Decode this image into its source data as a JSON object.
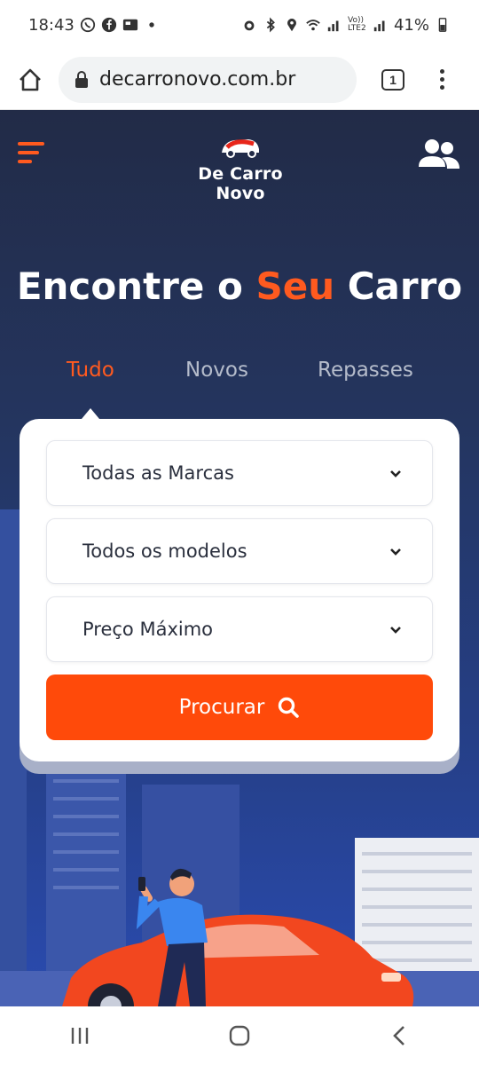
{
  "status_bar": {
    "time": "18:43",
    "battery": "41%",
    "network": "Vo)) LTE2"
  },
  "browser": {
    "url": "decarronovo.com.br",
    "tab_count": "1"
  },
  "site": {
    "logo_text": "De Carro Novo",
    "title_part1": "Encontre o ",
    "title_accent": "Seu",
    "title_part2": " Carro",
    "accent_color": "#ff5a1f",
    "tabs": [
      {
        "label": "Tudo",
        "active": true
      },
      {
        "label": "Novos",
        "active": false
      },
      {
        "label": "Repasses",
        "active": false
      }
    ],
    "selects": [
      {
        "label": "Todas as Marcas"
      },
      {
        "label": "Todos os modelos"
      },
      {
        "label": "Preço Máximo"
      }
    ],
    "search_button": "Procurar"
  }
}
